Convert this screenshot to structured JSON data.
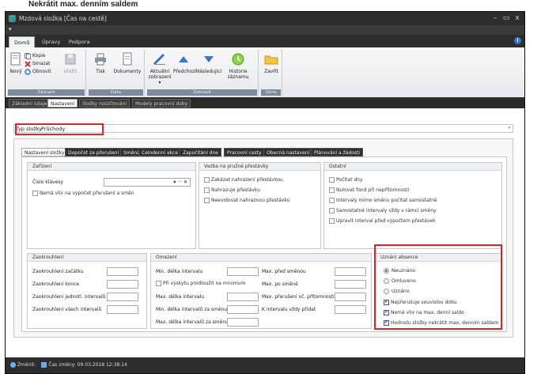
{
  "top_heading": "Nekrátit max. denním saldem",
  "window": {
    "title": "Mzdová složka [Čas na cestě]",
    "minimize": "–",
    "maximize": "▭",
    "close": "x",
    "qat_arrow": "▾"
  },
  "menu": {
    "tabs": [
      "Domů",
      "Úpravy",
      "Podpora"
    ],
    "help": "i"
  },
  "ribbon": {
    "groups": [
      {
        "label": "Záznam"
      },
      {
        "label": "Data"
      },
      {
        "label": "Zobrazit"
      },
      {
        "label": "Okno"
      }
    ],
    "buttons": {
      "new": "Nový",
      "copy": "Kopie",
      "delete": "Smazat",
      "refresh": "Obnovit",
      "save": "Uložit",
      "print": "Tisk",
      "documents": "Dokumenty",
      "current_view": "Aktuální",
      "current_view2": "zobrazení ▾",
      "previous": "Předchozí",
      "next": "Následující",
      "history": "Historie",
      "history2": "záznamu",
      "close": "Zavřít"
    }
  },
  "page_tabs": [
    "Základní údaje",
    "Nastavení",
    "Složky rozúčtování",
    "Modely pracovní doby"
  ],
  "type_field": {
    "label": "Typ složky",
    "value": "Průchody",
    "arrow": "▾"
  },
  "settings_tabs": [
    "Nastavení složky",
    "Dopočet za přerušení",
    "Směna",
    "Celodenní akce",
    "Započítání dne",
    "Pracovní cesty",
    "Obecná nastavení",
    "Plánování a žádosti"
  ],
  "sections": {
    "zarizeni": {
      "title": "Zařízení",
      "reader_label": "Číslo klávesy",
      "reader_controls": "▾ ··· ✕",
      "cb_no_effect": "Nemá vliv na výpočet přerušení a směn"
    },
    "vazba": {
      "title": "Vazba na pružné přestávky",
      "items": [
        "Zakázat nahrazení přestávkou",
        "Nahrazuje přestávku",
        "Neevidovat nahraznou přestávku"
      ]
    },
    "ostatni": {
      "title": "Ostatní",
      "items": [
        "Počítat dny",
        "Nulovat fond při nepřítomnosti",
        "Intervaly mimo směnu počítat samostatně",
        "Samostatné intervaly vždy v rámci směny",
        "Upravit interval před výpočtem přestávek"
      ]
    },
    "zaokrouhleni": {
      "title": "Zaokrouhlení",
      "fields": [
        "Zaokrouhlení začátku",
        "Zaokrouhlení konce",
        "Zaokrouhlení jednotl. intervalů",
        "Zaokrouhlení všech intervalů"
      ]
    },
    "omezeni": {
      "title": "Omezení",
      "left_fields": [
        "Min. délka intervalu",
        "Při výskytu prodloužit na minimum",
        "Max. délka intervalu",
        "Min. délka intervalů za směnu",
        "Max. délka intervalů za směnu"
      ],
      "right_fields": [
        "Max. před směnou",
        "Max. po směně",
        "Max. přerušení vč. přítomnosti",
        "K intervalu vždy přidat"
      ]
    },
    "uznani": {
      "title": "Uznání absence",
      "radios": [
        "Neuznáno",
        "Omluveno",
        "Uznáno"
      ],
      "checks": [
        "Nepřerušuje souvislou dobu",
        "Nemá vliv na max. denní saldo",
        "Hodnotu složky nekrátit max. denním saldem"
      ]
    }
  },
  "status": {
    "changed": "Změnil:",
    "change_time": "Čas změny: 09.03.2018 12:38:14"
  },
  "colors": {
    "highlight": "#d9252a",
    "dark_chrome": "#2d2d2d",
    "accent": "#2f78d4"
  }
}
